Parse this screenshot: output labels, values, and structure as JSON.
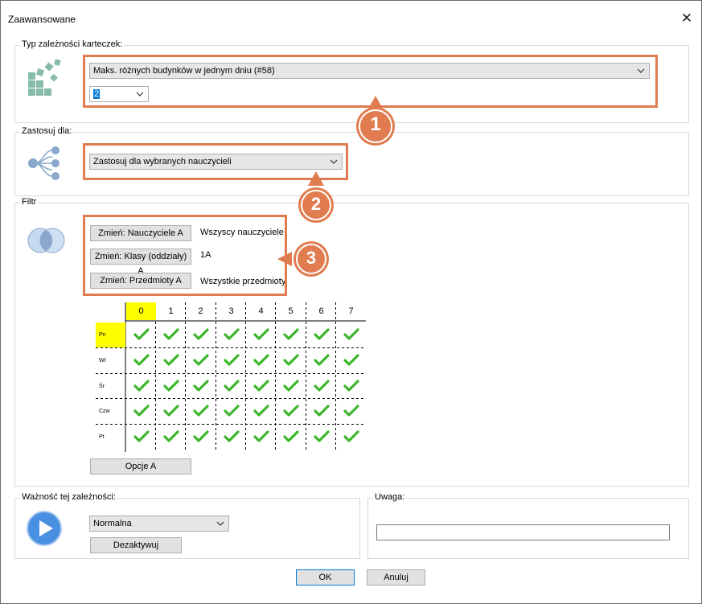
{
  "window": {
    "title": "Zaawansowane",
    "close_symbol": "✕"
  },
  "type_group": {
    "label": "Typ zależności karteczek:",
    "constraint_value": "Maks. różnych budynków w jednym dniu (#58)",
    "count_value": "2"
  },
  "apply_group": {
    "label": "Zastosuj dla:",
    "value": "Zastosuj dla wybranych nauczycieli"
  },
  "filter_group": {
    "label": "Filtr",
    "rows": [
      {
        "button": "Zmień: Nauczyciele A",
        "value": "Wszyscy nauczyciele"
      },
      {
        "button": "Zmień: Klasy (oddziały) A",
        "value": "1A"
      },
      {
        "button": "Zmień: Przedmioty A",
        "value": "Wszystkie przedmioty"
      }
    ],
    "grid": {
      "columns": [
        "0",
        "1",
        "2",
        "3",
        "4",
        "5",
        "6",
        "7"
      ],
      "rows": [
        "Pn",
        "Wt",
        "Śr",
        "Czw",
        "Pt"
      ],
      "selected_column": "0",
      "selected_row": "Pn",
      "all_checked": true
    },
    "options_button": "Opcje A"
  },
  "importance_group": {
    "label": "Ważność tej zależności:",
    "value": "Normalna",
    "deactivate_button": "Dezaktywuj"
  },
  "note_group": {
    "label": "Uwaga:",
    "value": ""
  },
  "footer": {
    "ok": "OK",
    "cancel": "Anuluj"
  },
  "callouts": [
    "1",
    "2",
    "3"
  ],
  "colors": {
    "highlight": "#e07c4f",
    "check": "#3cb62a",
    "selected": "#ffff00",
    "play": "#4a90e2"
  }
}
